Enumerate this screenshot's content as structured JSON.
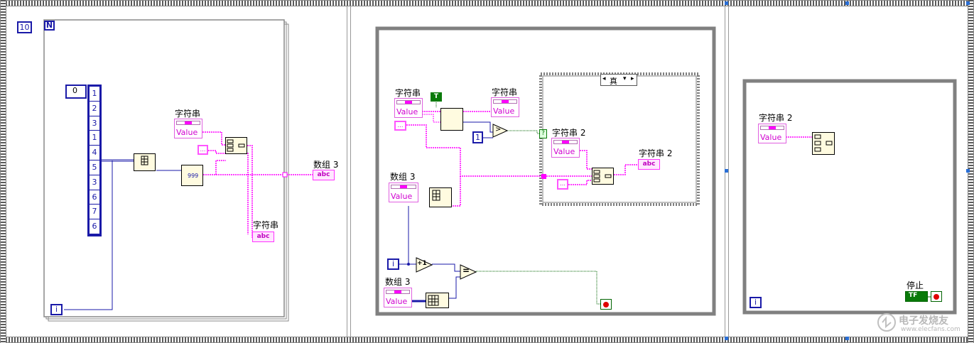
{
  "diagram": {
    "frame1": {
      "loop_count": "10",
      "loop_n": "N",
      "array_index": "0",
      "array_values": [
        "1",
        "2",
        "3",
        "1",
        "4",
        "5",
        "3",
        "6",
        "7",
        "6"
      ],
      "string_control_label": "字符串",
      "string_value": "Value",
      "format_code": "999",
      "array_indicator_label": "数组 3",
      "string_indicator_label": "字符串",
      "indicator_text": "abc",
      "iteration": "i"
    },
    "frame2": {
      "string_control_label": "字符串",
      "string_value": "Value",
      "bool_const": "T",
      "string_indicator_label": "字符串",
      "numeric_const": "1",
      "case_selector": "真",
      "case_string_control_label": "字符串 2",
      "case_string_indicator_label": "字符串 2",
      "array_label": "数组 3",
      "array_label_2": "数组 3",
      "plus_one": "+1",
      "equal": "=",
      "compare": ">",
      "question": "?",
      "iteration": "i",
      "indicator_text": "abc"
    },
    "frame3": {
      "string_control_label": "字符串 2",
      "string_value": "Value",
      "stop_label": "停止",
      "stop_tf": "TF",
      "iteration": "i"
    },
    "watermark": "电子发烧友",
    "watermark_url": "www.elecfans.com"
  },
  "colors": {
    "string_wire": "#ff00ff",
    "numeric_wire": "#1a1aa8",
    "boolean_wire": "#006400",
    "structure": "#808080"
  }
}
